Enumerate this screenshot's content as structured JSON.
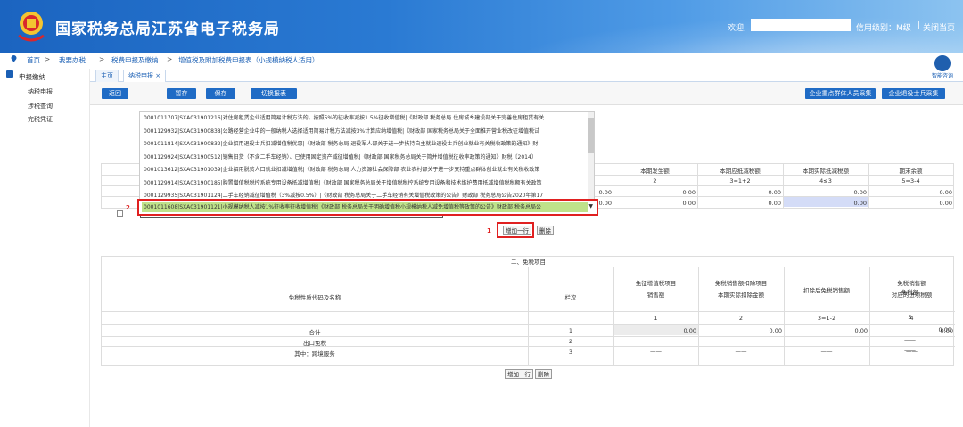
{
  "header": {
    "site_title": "国家税务总局江苏省电子税务局",
    "welcome": "欢迎,",
    "credit": "信用级别：M级",
    "close_page": "关闭当页",
    "separator": "|"
  },
  "breadcrumb": [
    "首页",
    ">",
    "我要办税",
    ">",
    "税费申报及缴纳",
    ">",
    "增值税及附加税费申报表（小规模纳税人适用）"
  ],
  "sidebar": {
    "title": "申报缴纳",
    "items": [
      "纳税申报",
      "涉税查询",
      "完税凭证"
    ]
  },
  "tabs": [
    "主页",
    "纳税申报 ×"
  ],
  "help_label": "智能咨询",
  "toolbar": {
    "back": "返回",
    "save_draft": "暂存",
    "save": "保存",
    "switch": "切换报表",
    "right1": "企业重点群体人员采集",
    "right2": "企业退役士兵采集"
  },
  "table1": {
    "headers": [
      "本期发生额",
      "本期应抵减税额",
      "本期实际抵减税额",
      "期末余额"
    ],
    "col_numbers": [
      "2",
      "3=1+2",
      "4≤3",
      "5=3-4"
    ],
    "row1": [
      "0.00",
      "0.00",
      "0.00",
      "0.00",
      "0.00"
    ],
    "row2": [
      "0.00",
      "0.00",
      "0.00",
      "0.00",
      "0.00"
    ]
  },
  "dropdown": {
    "items": [
      "0001011707|SXA031901216|对住房租赁企业适用简易计税方法的，按照5%的征收率减按1.5%征收增值税|《财政部 税务总局 住房城乡建设部关于完善住房租赁有关",
      "0001129932|SXA031900838|公路经营企业中的一般纳税人选择适用简易计税方法减按3%计算应纳增值税|《财政部 国家税务总局关于全面推开营业税改征增值税试",
      "0001011814|SXA031900832|企业招用退役士兵扣减增值税优惠|《财政部 税务总局 退役军人部关于进一步扶持自主就业退役士兵创业就业有关税收政策的通知》财",
      "0001129924|SXA031900512|销售旧货（不含二手车经销）、已使用固定资产减征增值税|《财政部 国家税务总局关于简并增值税征收率政策的通知》财税〔2014〕",
      "0001013612|SXA031901039|企业招用脱贫人口就业扣减增值税|《财政部 税务总局 人力资源社会保障部 农业农村部关于进一步支持重点群体创业就业有关税收政策",
      "0001129914|SXA031900185|购置增值税税控系统专用设备抵减增值税|《财政部 国家税务总局关于增值税税控系统专用设备和技术维护费用抵减增值税税额有关政策",
      "0001129935|SXA031901124|二手车经销减征增值税（3%减按0.5%）|《财政部 税务总局关于二手车经销有关增值税政策的公告》财政部 税务总局公告2020年第17"
    ],
    "selected": "0001011608|SXA031901121|小规模纳税人减按1%征收率征收增值税|《财政部 税务总局关于明确增值税小规模纳税人减免增值税等政策的公告》财政部 税务总局公"
  },
  "markers": [
    "2",
    "1"
  ],
  "row_buttons": {
    "add": "增加一行",
    "delete": "删除"
  },
  "table2": {
    "title": "二、免税项目",
    "col_name": "免税性质代码及名称",
    "col_row": "栏次",
    "col_headers": [
      "免征增值税项目\n销售额",
      "免税销售额扣除项目\n本期实际扣除金额",
      "扣除后免税销售额",
      "免税销售额\n对应的进项税额",
      "免税额"
    ],
    "col_numbers": [
      "1",
      "2",
      "3=1-2",
      "4",
      "5"
    ],
    "rows": [
      {
        "name": "合计",
        "no": "1",
        "values": [
          "0.00",
          "0.00",
          "0.00",
          "0.00",
          "0.00"
        ]
      },
      {
        "name": "出口免税",
        "no": "2",
        "values": [
          "——",
          "——",
          "——",
          "——",
          "——"
        ]
      },
      {
        "name": "其中：跨境服务",
        "no": "3",
        "values": [
          "——",
          "——",
          "——",
          "——",
          "——"
        ]
      }
    ]
  },
  "colors": {
    "primary": "#1f6bc5",
    "highlight": "#e02020",
    "selected_bg": "#bfe28a"
  }
}
